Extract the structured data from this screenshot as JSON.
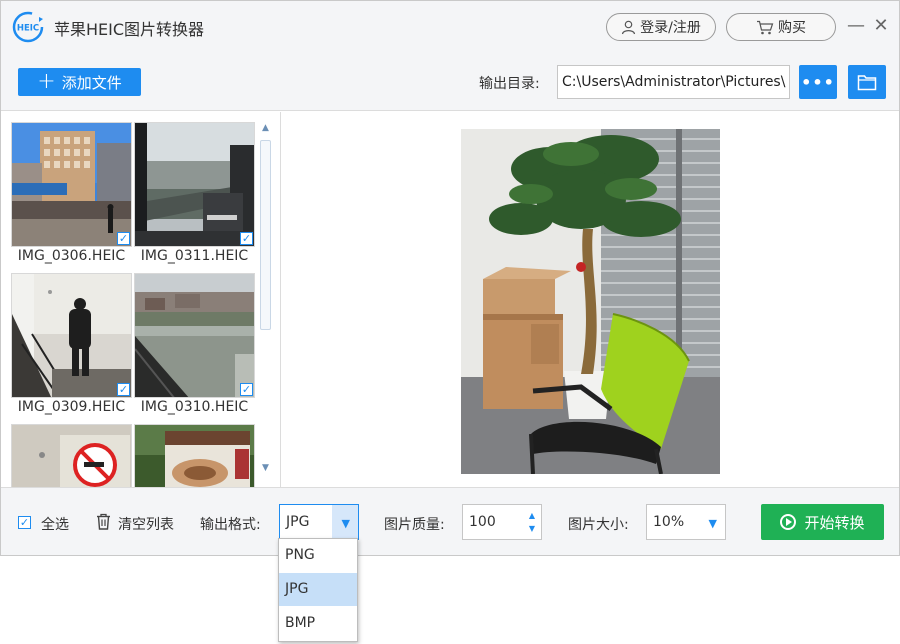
{
  "titlebar": {
    "app_title": "苹果HEIC图片转换器",
    "logo_text": "HEIC",
    "login_label": "登录/注册",
    "buy_label": "购买",
    "minimize_glyph": "—",
    "close_glyph": "✕"
  },
  "toolbar": {
    "add_files_label": "添加文件",
    "output_dir_label": "输出目录:",
    "output_dir_value": "C:\\Users\\Administrator\\Pictures\\",
    "more_glyph": "•••"
  },
  "file_list": {
    "items": [
      {
        "name": "IMG_0306.HEIC",
        "checked": true
      },
      {
        "name": "IMG_0311.HEIC",
        "checked": true
      },
      {
        "name": "IMG_0309.HEIC",
        "checked": true
      },
      {
        "name": "IMG_0310.HEIC",
        "checked": true
      }
    ]
  },
  "bottom": {
    "select_all_label": "全选",
    "select_all_checked": true,
    "clear_list_label": "清空列表",
    "format_label": "输出格式:",
    "format_value": "JPG",
    "quality_label": "图片质量:",
    "quality_value": "100",
    "size_label": "图片大小:",
    "size_value": "10%",
    "start_label": "开始转换"
  },
  "format_dropdown": {
    "options": [
      "PNG",
      "JPG",
      "BMP"
    ],
    "selected": "JPG"
  },
  "colors": {
    "accent": "#1e8cf0",
    "start_button": "#1fb155",
    "selected_option": "#c6dff8"
  },
  "icons": [
    "heic-logo-icon",
    "user-icon",
    "cart-icon",
    "minimize-icon",
    "close-icon",
    "plus-icon",
    "more-icon",
    "folder-icon",
    "check-icon",
    "trash-icon",
    "chevron-down-icon",
    "play-circle-icon"
  ]
}
